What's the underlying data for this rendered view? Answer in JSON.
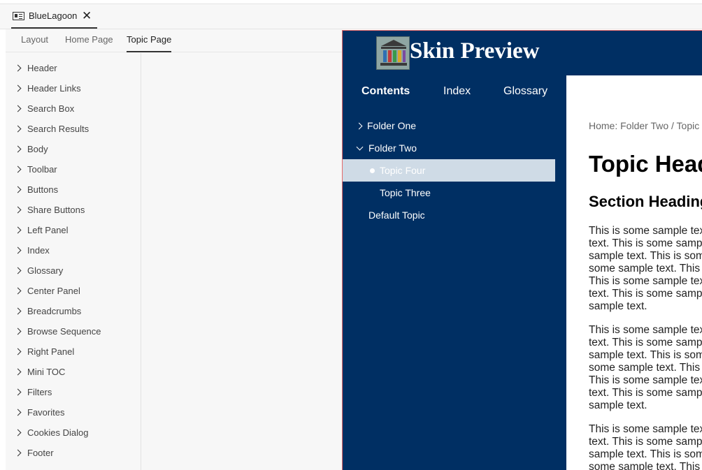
{
  "file_tab": {
    "title": "BlueLagoon",
    "close": "✕"
  },
  "sub_tabs": [
    {
      "label": "Layout"
    },
    {
      "label": "Home Page"
    },
    {
      "label": "Topic Page"
    }
  ],
  "tree": [
    {
      "label": "Header"
    },
    {
      "label": "Header Links"
    },
    {
      "label": "Search Box"
    },
    {
      "label": "Search Results"
    },
    {
      "label": "Body"
    },
    {
      "label": "Toolbar"
    },
    {
      "label": "Buttons"
    },
    {
      "label": "Share Buttons"
    },
    {
      "label": "Left Panel"
    },
    {
      "label": "Index"
    },
    {
      "label": "Glossary"
    },
    {
      "label": "Center Panel"
    },
    {
      "label": "Breadcrumbs"
    },
    {
      "label": "Browse Sequence"
    },
    {
      "label": "Right Panel"
    },
    {
      "label": "Mini TOC"
    },
    {
      "label": "Filters"
    },
    {
      "label": "Favorites"
    },
    {
      "label": "Cookies Dialog"
    },
    {
      "label": "Footer"
    }
  ],
  "preview": {
    "title": "Skin Preview",
    "nav_tabs": [
      {
        "label": "Contents"
      },
      {
        "label": "Index"
      },
      {
        "label": "Glossary"
      }
    ],
    "toc": [
      {
        "label": "Folder One"
      },
      {
        "label": "Folder Two"
      },
      {
        "label": "Topic Four"
      },
      {
        "label": "Topic Three"
      },
      {
        "label": "Default Topic"
      }
    ],
    "breadcrumb": "Home: Folder Two  /  Topic",
    "topic_heading": "Topic Heading",
    "section_heading": "Section Heading",
    "paragraph_lines": [
      "This is some sample text.",
      "text. This is some sample",
      "sample text. This is some",
      "some sample text. This is",
      "This is some sample text.",
      "text. This is some sample",
      "sample text."
    ],
    "paragraph_lines_3": [
      "This is some sample text.",
      "text. This is some sample",
      "sample text. This is some",
      "some sample text. This is"
    ]
  },
  "colors": {
    "preview_bg": "#002f63",
    "selected_bg": "#cfdbe6",
    "preview_border": "#e56b6b"
  }
}
